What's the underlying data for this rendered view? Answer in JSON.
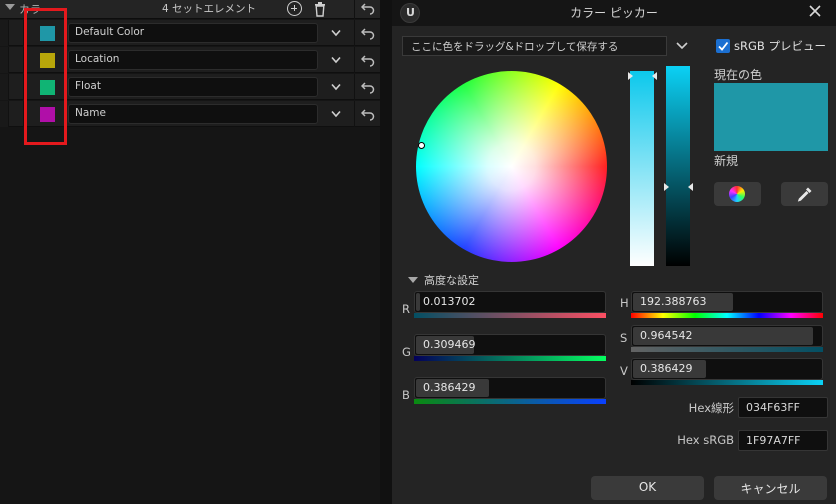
{
  "left_panel": {
    "header_label": "カラ",
    "element_count": "4 セットエレメント",
    "rows": [
      {
        "name": "Default Color",
        "swatch": "#1F97A7"
      },
      {
        "name": "Location",
        "swatch": "#B8A60A"
      },
      {
        "name": "Float",
        "swatch": "#10B474"
      },
      {
        "name": "Name",
        "swatch": "#B00FA8"
      }
    ]
  },
  "picker": {
    "title": "カラー ピッカー",
    "dropzone": "ここに色をドラッグ&ドロップして保存する",
    "srgb_preview": "sRGB プレビュー",
    "current_color_label": "現在の色",
    "new_label": "新規",
    "advanced_label": "高度な設定",
    "channels": {
      "R": {
        "label": "R",
        "value": "0.013702",
        "fraction": 0.01
      },
      "G": {
        "label": "G",
        "value": "0.309469",
        "fraction": 0.31
      },
      "B": {
        "label": "B",
        "value": "0.386429",
        "fraction": 0.39
      },
      "H": {
        "label": "H",
        "value": "192.388763",
        "fraction": 0.53
      },
      "S": {
        "label": "S",
        "value": "0.964542",
        "fraction": 0.96
      },
      "V": {
        "label": "V",
        "value": "0.386429",
        "fraction": 0.39
      }
    },
    "hex_linear_label": "Hex線形",
    "hex_linear_value": "034F63FF",
    "hex_srgb_label": "Hex sRGB",
    "hex_srgb_value": "1F97A7FF",
    "ok_label": "OK",
    "cancel_label": "キャンセル",
    "current_color": "#1F97A7"
  }
}
